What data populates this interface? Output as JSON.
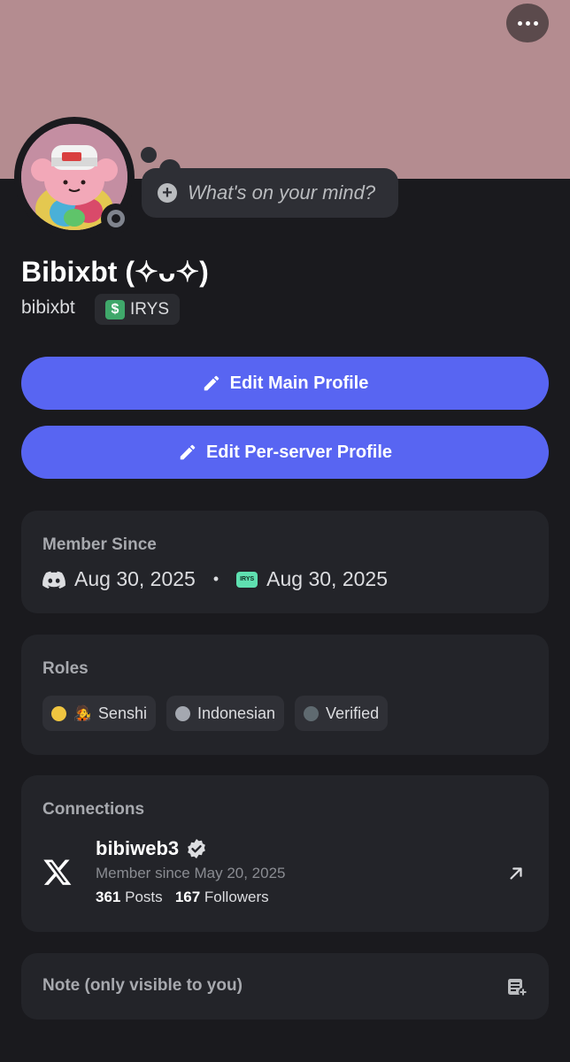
{
  "header": {
    "more_label": "More options"
  },
  "profile": {
    "thought_placeholder": "What's on your mind?",
    "display_name": "Bibixbt (✧ᴗ✧)",
    "username": "bibixbt",
    "server_tag": "IRYS"
  },
  "actions": {
    "edit_main": "Edit Main Profile",
    "edit_server": "Edit Per-server Profile"
  },
  "member_since": {
    "title": "Member Since",
    "discord_date": "Aug 30, 2025",
    "separator": "•",
    "server_date": "Aug 30, 2025",
    "server_icon_text": "IRYS"
  },
  "roles": {
    "title": "Roles",
    "items": [
      {
        "label": "Senshi",
        "color": "#f0c540",
        "emoji": "🧑‍🎤"
      },
      {
        "label": "Indonesian",
        "color": "#a4a8b0"
      },
      {
        "label": "Verified",
        "color": "#5f6a70"
      }
    ]
  },
  "connections": {
    "title": "Connections",
    "account": {
      "name": "bibiweb3",
      "since": "Member since May 20, 2025",
      "posts_count": "361",
      "posts_label": "Posts",
      "followers_count": "167",
      "followers_label": "Followers"
    }
  },
  "note": {
    "label": "Note (only visible to you)"
  },
  "colors": {
    "banner": "#b48c90",
    "accent": "#5865f2",
    "background": "#1a1a1e",
    "card": "#232429"
  }
}
